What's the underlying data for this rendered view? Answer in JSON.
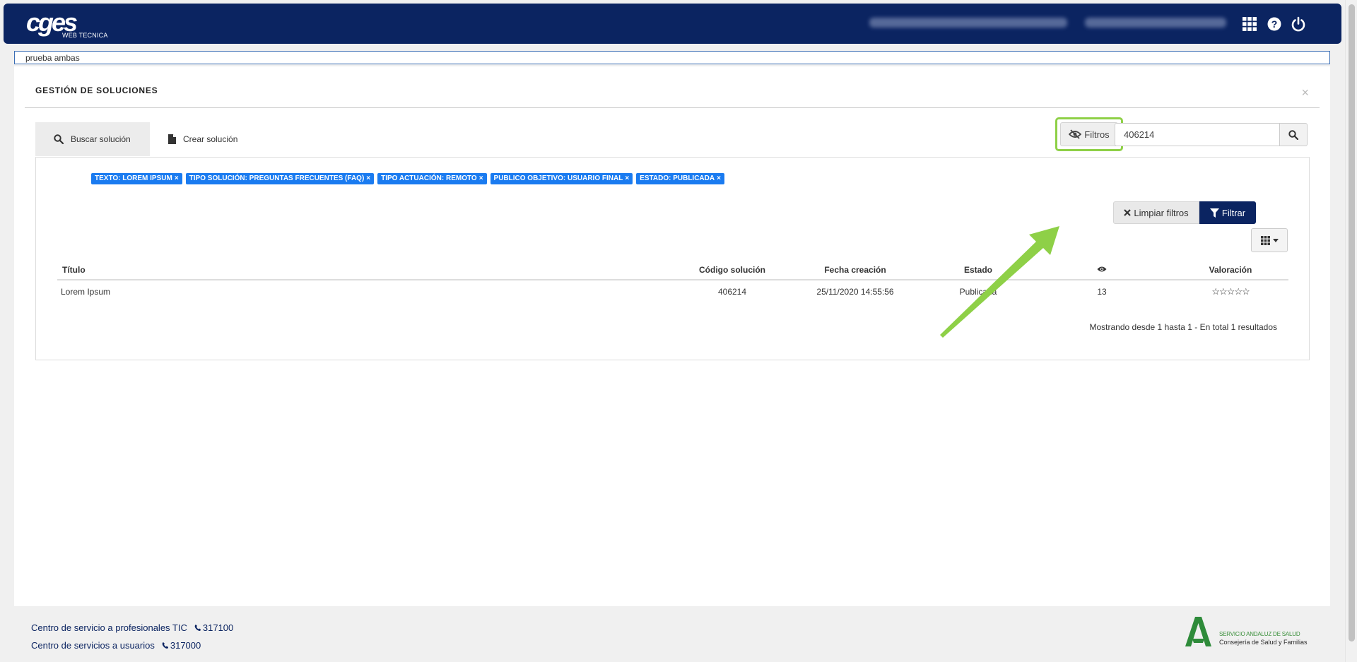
{
  "header": {
    "logo_text": "cges",
    "logo_subtext": "WEB TECNICA",
    "apps_icon": "grid-icon",
    "help_icon": "question-circle-icon",
    "power_icon": "power-icon"
  },
  "top_search": {
    "value": "prueba ambas"
  },
  "page": {
    "title": "GESTIÓN DE SOLUCIONES",
    "close_label": "×"
  },
  "tabs": [
    {
      "label": "Buscar solución",
      "icon": "search-icon",
      "active": true
    },
    {
      "label": "Crear solución",
      "icon": "file-icon",
      "active": false
    }
  ],
  "toolbar": {
    "filtros_label": "Filtros",
    "filtros_icon": "eye-slash-icon",
    "search_value": "406214",
    "search_icon": "search-icon"
  },
  "filter_chips": [
    "TEXTO: LOREM IPSUM",
    "TIPO SOLUCIÓN: PREGUNTAS FRECUENTES (FAQ)",
    "TIPO ACTUACIÓN: REMOTO",
    "PUBLICO OBJETIVO: USUARIO FINAL",
    "ESTADO: PUBLICADA"
  ],
  "chip_remove": "×",
  "actions": {
    "clear_label": "Limpiar filtros",
    "filter_label": "Filtrar"
  },
  "table": {
    "headers": {
      "title": "Título",
      "code": "Código solución",
      "date": "Fecha creación",
      "status": "Estado",
      "views_icon": "eye-icon",
      "rating": "Valoración"
    },
    "rows": [
      {
        "title": "Lorem Ipsum",
        "code": "406214",
        "date": "25/11/2020 14:55:56",
        "status": "Publicada",
        "views": "13",
        "rating": "☆☆☆☆☆"
      }
    ],
    "summary": "Mostrando desde 1 hasta 1 - En total 1 resultados"
  },
  "footer": {
    "line1": "Centro de servicio a profesionales TIC",
    "phone1": "317100",
    "line2": "Centro de servicios a usuarios",
    "phone2": "317000",
    "org_line1": "SERVICIO ANDALUZ DE SALUD",
    "org_line2": "Consejería de Salud y Familias"
  },
  "colors": {
    "navy": "#0b2461",
    "chip_blue": "#1a7bf0",
    "highlight_green": "#8ed047",
    "sas_green": "#2e8b3a"
  }
}
